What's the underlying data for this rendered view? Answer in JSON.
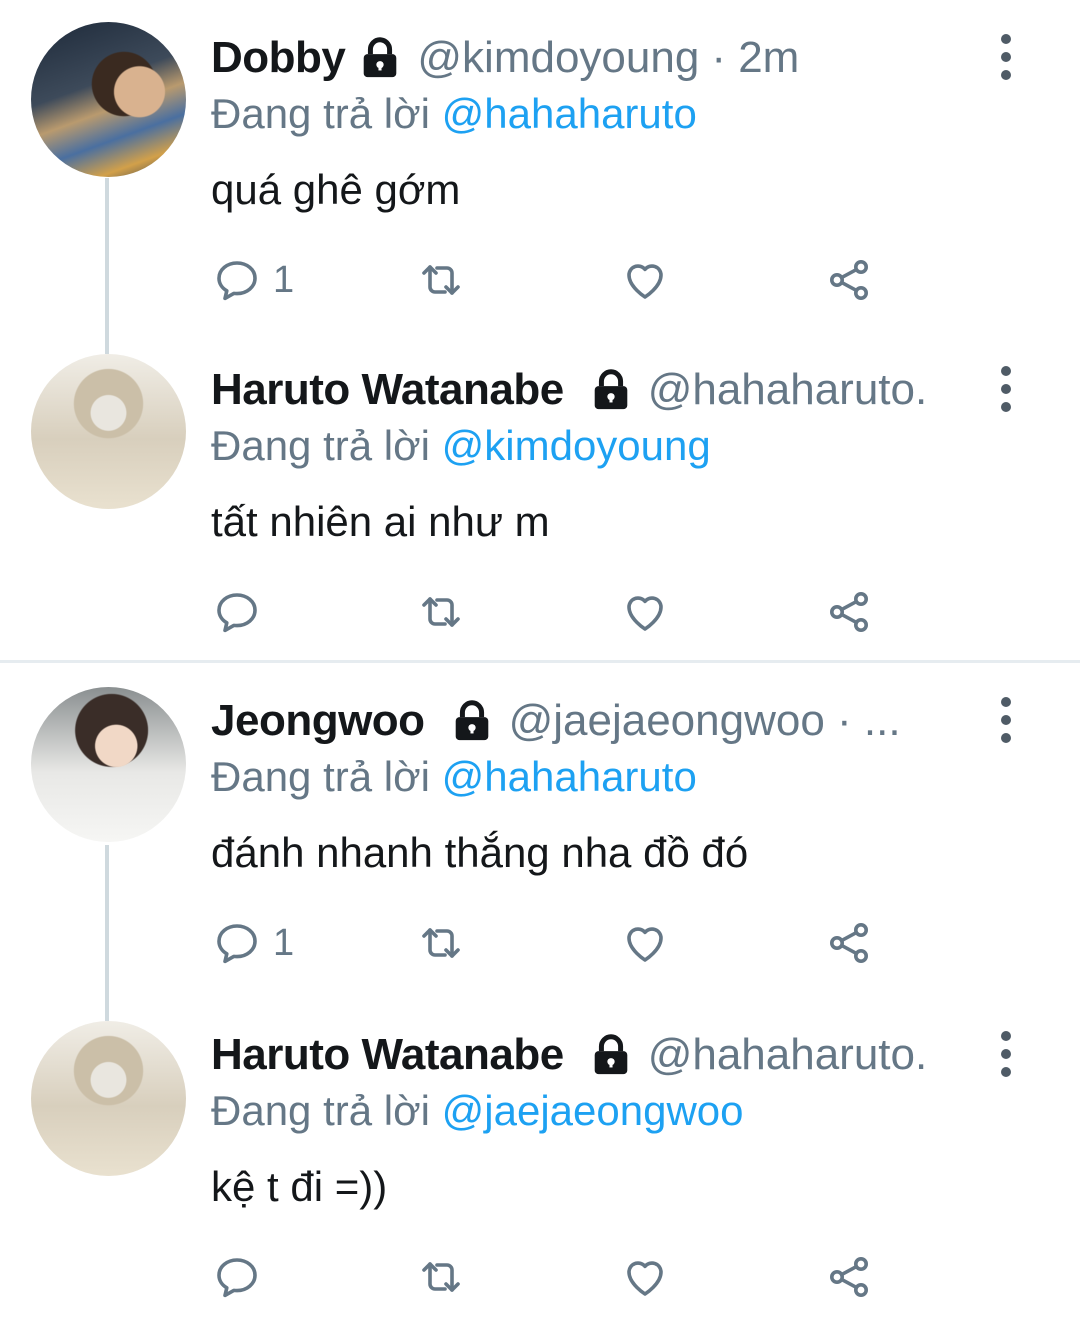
{
  "tweets": [
    {
      "name": "Dobby",
      "handle": "@kimdoyoung",
      "time": "· 2m",
      "reply_prefix": "Đang trả lời",
      "reply_to": "@hahaharuto",
      "text": "quá ghê gớm",
      "reply_count": "1",
      "avatar": "dobby"
    },
    {
      "name": "Haruto Watanabe",
      "handle": "@hahaharuto.",
      "time": "",
      "reply_prefix": "Đang trả lời",
      "reply_to": "@kimdoyoung",
      "text": "tất nhiên ai như m",
      "reply_count": "",
      "avatar": "haruto"
    },
    {
      "name": "Jeongwoo",
      "handle": "@jaejaeongwoo · ...",
      "time": "",
      "reply_prefix": "Đang trả lời",
      "reply_to": "@hahaharuto",
      "text": "đánh nhanh thắng nha đồ đó",
      "reply_count": "1",
      "avatar": "jeongwoo"
    },
    {
      "name": "Haruto Watanabe",
      "handle": "@hahaharuto.",
      "time": "",
      "reply_prefix": "Đang trả lời",
      "reply_to": "@jaejaeongwoo",
      "text": "kệ t đi =))",
      "reply_count": "",
      "avatar": "haruto"
    }
  ],
  "icons": {
    "lock": "lock-icon",
    "reply": "reply-icon",
    "retweet": "retweet-icon",
    "like": "heart-icon",
    "share": "share-icon",
    "more": "more-vertical-icon"
  },
  "colors": {
    "name": "#14171a",
    "secondary": "#657786",
    "mention": "#1da1f2",
    "thread_line": "#cfd9de",
    "divider": "#e6ecf0"
  }
}
